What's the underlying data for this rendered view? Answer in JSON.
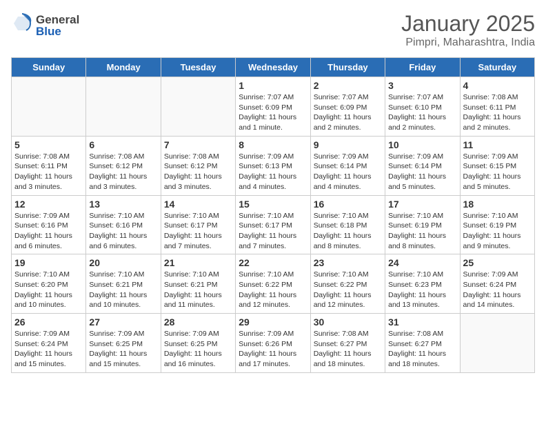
{
  "header": {
    "logo": {
      "general": "General",
      "blue": "Blue"
    },
    "title": "January 2025",
    "location": "Pimpri, Maharashtra, India"
  },
  "weekdays": [
    "Sunday",
    "Monday",
    "Tuesday",
    "Wednesday",
    "Thursday",
    "Friday",
    "Saturday"
  ],
  "weeks": [
    [
      {
        "day": "",
        "info": ""
      },
      {
        "day": "",
        "info": ""
      },
      {
        "day": "",
        "info": ""
      },
      {
        "day": "1",
        "info": "Sunrise: 7:07 AM\nSunset: 6:09 PM\nDaylight: 11 hours\nand 1 minute."
      },
      {
        "day": "2",
        "info": "Sunrise: 7:07 AM\nSunset: 6:09 PM\nDaylight: 11 hours\nand 2 minutes."
      },
      {
        "day": "3",
        "info": "Sunrise: 7:07 AM\nSunset: 6:10 PM\nDaylight: 11 hours\nand 2 minutes."
      },
      {
        "day": "4",
        "info": "Sunrise: 7:08 AM\nSunset: 6:11 PM\nDaylight: 11 hours\nand 2 minutes."
      }
    ],
    [
      {
        "day": "5",
        "info": "Sunrise: 7:08 AM\nSunset: 6:11 PM\nDaylight: 11 hours\nand 3 minutes."
      },
      {
        "day": "6",
        "info": "Sunrise: 7:08 AM\nSunset: 6:12 PM\nDaylight: 11 hours\nand 3 minutes."
      },
      {
        "day": "7",
        "info": "Sunrise: 7:08 AM\nSunset: 6:12 PM\nDaylight: 11 hours\nand 3 minutes."
      },
      {
        "day": "8",
        "info": "Sunrise: 7:09 AM\nSunset: 6:13 PM\nDaylight: 11 hours\nand 4 minutes."
      },
      {
        "day": "9",
        "info": "Sunrise: 7:09 AM\nSunset: 6:14 PM\nDaylight: 11 hours\nand 4 minutes."
      },
      {
        "day": "10",
        "info": "Sunrise: 7:09 AM\nSunset: 6:14 PM\nDaylight: 11 hours\nand 5 minutes."
      },
      {
        "day": "11",
        "info": "Sunrise: 7:09 AM\nSunset: 6:15 PM\nDaylight: 11 hours\nand 5 minutes."
      }
    ],
    [
      {
        "day": "12",
        "info": "Sunrise: 7:09 AM\nSunset: 6:16 PM\nDaylight: 11 hours\nand 6 minutes."
      },
      {
        "day": "13",
        "info": "Sunrise: 7:10 AM\nSunset: 6:16 PM\nDaylight: 11 hours\nand 6 minutes."
      },
      {
        "day": "14",
        "info": "Sunrise: 7:10 AM\nSunset: 6:17 PM\nDaylight: 11 hours\nand 7 minutes."
      },
      {
        "day": "15",
        "info": "Sunrise: 7:10 AM\nSunset: 6:17 PM\nDaylight: 11 hours\nand 7 minutes."
      },
      {
        "day": "16",
        "info": "Sunrise: 7:10 AM\nSunset: 6:18 PM\nDaylight: 11 hours\nand 8 minutes."
      },
      {
        "day": "17",
        "info": "Sunrise: 7:10 AM\nSunset: 6:19 PM\nDaylight: 11 hours\nand 8 minutes."
      },
      {
        "day": "18",
        "info": "Sunrise: 7:10 AM\nSunset: 6:19 PM\nDaylight: 11 hours\nand 9 minutes."
      }
    ],
    [
      {
        "day": "19",
        "info": "Sunrise: 7:10 AM\nSunset: 6:20 PM\nDaylight: 11 hours\nand 10 minutes."
      },
      {
        "day": "20",
        "info": "Sunrise: 7:10 AM\nSunset: 6:21 PM\nDaylight: 11 hours\nand 10 minutes."
      },
      {
        "day": "21",
        "info": "Sunrise: 7:10 AM\nSunset: 6:21 PM\nDaylight: 11 hours\nand 11 minutes."
      },
      {
        "day": "22",
        "info": "Sunrise: 7:10 AM\nSunset: 6:22 PM\nDaylight: 11 hours\nand 12 minutes."
      },
      {
        "day": "23",
        "info": "Sunrise: 7:10 AM\nSunset: 6:22 PM\nDaylight: 11 hours\nand 12 minutes."
      },
      {
        "day": "24",
        "info": "Sunrise: 7:10 AM\nSunset: 6:23 PM\nDaylight: 11 hours\nand 13 minutes."
      },
      {
        "day": "25",
        "info": "Sunrise: 7:09 AM\nSunset: 6:24 PM\nDaylight: 11 hours\nand 14 minutes."
      }
    ],
    [
      {
        "day": "26",
        "info": "Sunrise: 7:09 AM\nSunset: 6:24 PM\nDaylight: 11 hours\nand 15 minutes."
      },
      {
        "day": "27",
        "info": "Sunrise: 7:09 AM\nSunset: 6:25 PM\nDaylight: 11 hours\nand 15 minutes."
      },
      {
        "day": "28",
        "info": "Sunrise: 7:09 AM\nSunset: 6:25 PM\nDaylight: 11 hours\nand 16 minutes."
      },
      {
        "day": "29",
        "info": "Sunrise: 7:09 AM\nSunset: 6:26 PM\nDaylight: 11 hours\nand 17 minutes."
      },
      {
        "day": "30",
        "info": "Sunrise: 7:08 AM\nSunset: 6:27 PM\nDaylight: 11 hours\nand 18 minutes."
      },
      {
        "day": "31",
        "info": "Sunrise: 7:08 AM\nSunset: 6:27 PM\nDaylight: 11 hours\nand 18 minutes."
      },
      {
        "day": "",
        "info": ""
      }
    ]
  ]
}
